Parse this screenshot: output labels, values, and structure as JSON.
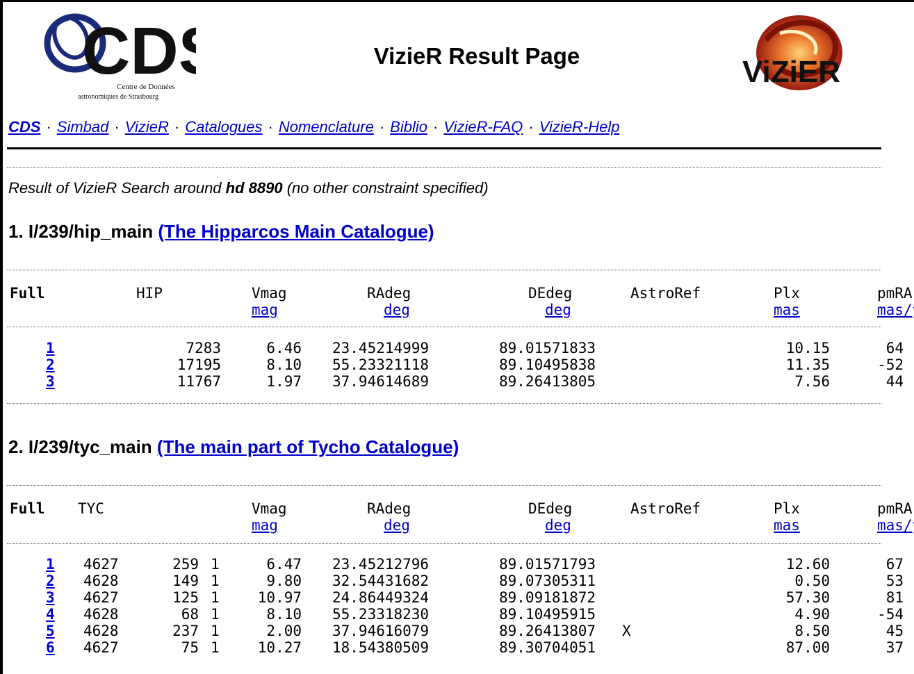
{
  "header": {
    "title": "VizieR Result Page",
    "cds_logo_text": "CDS",
    "cds_logo_subtitle_1": "Centre de Données",
    "cds_logo_subtitle_2": "astronomiques de Strasbourg",
    "vizier_logo_text": "ViZiER"
  },
  "nav": [
    {
      "label": "CDS"
    },
    {
      "label": "Simbad"
    },
    {
      "label": "VizieR"
    },
    {
      "label": "Catalogues"
    },
    {
      "label": "Nomenclature"
    },
    {
      "label": "Biblio"
    },
    {
      "label": "VizieR-FAQ"
    },
    {
      "label": "VizieR-Help"
    }
  ],
  "search": {
    "prefix": "Result of VizieR Search around",
    "target": "hd 8890",
    "suffix": "(no other constraint specified)"
  },
  "catalogs": [
    {
      "number": "1. I/239/hip_main",
      "link": "(The Hipparcos Main Catalogue)",
      "headers": {
        "full": "Full",
        "id": "HIP",
        "vmag": "Vmag",
        "vmag_unit": "mag",
        "ra": "RAdeg",
        "ra_unit": "deg",
        "de": "DEdeg",
        "de_unit": "deg",
        "astroref": "AstroRef",
        "plx": "Plx",
        "plx_unit": "mas",
        "pmra": "pmRA",
        "pmra_unit": "mas/yr"
      },
      "rows": [
        {
          "n": "1",
          "id": "7283",
          "vmag": "6.46",
          "ra": "23.45214999",
          "de": "89.01571833",
          "astroref": "",
          "plx": "10.15",
          "pmra": "64"
        },
        {
          "n": "2",
          "id": "17195",
          "vmag": "8.10",
          "ra": "55.23321118",
          "de": "89.10495838",
          "astroref": "",
          "plx": "11.35",
          "pmra": "-52"
        },
        {
          "n": "3",
          "id": "11767",
          "vmag": "1.97",
          "ra": "37.94614689",
          "de": "89.26413805",
          "astroref": "",
          "plx": "7.56",
          "pmra": "44"
        }
      ]
    },
    {
      "number": "2. I/239/tyc_main",
      "link": "(The main part of Tycho Catalogue)",
      "headers": {
        "full": "Full",
        "id": "TYC",
        "vmag": "Vmag",
        "vmag_unit": "mag",
        "ra": "RAdeg",
        "ra_unit": "deg",
        "de": "DEdeg",
        "de_unit": "deg",
        "astroref": "AstroRef",
        "plx": "Plx",
        "plx_unit": "mas",
        "pmra": "pmRA",
        "pmra_unit": "mas/yr"
      },
      "rows": [
        {
          "n": "1",
          "id1": "4627",
          "id2": "259",
          "id3": "1",
          "vmag": "6.47",
          "ra": "23.45212796",
          "de": "89.01571793",
          "astroref": "",
          "plx": "12.60",
          "pmra": "67"
        },
        {
          "n": "2",
          "id1": "4628",
          "id2": "149",
          "id3": "1",
          "vmag": "9.80",
          "ra": "32.54431682",
          "de": "89.07305311",
          "astroref": "",
          "plx": "0.50",
          "pmra": "53"
        },
        {
          "n": "3",
          "id1": "4627",
          "id2": "125",
          "id3": "1",
          "vmag": "10.97",
          "ra": "24.86449324",
          "de": "89.09181872",
          "astroref": "",
          "plx": "57.30",
          "pmra": "81"
        },
        {
          "n": "4",
          "id1": "4628",
          "id2": "68",
          "id3": "1",
          "vmag": "8.10",
          "ra": "55.23318230",
          "de": "89.10495915",
          "astroref": "",
          "plx": "4.90",
          "pmra": "-54"
        },
        {
          "n": "5",
          "id1": "4628",
          "id2": "237",
          "id3": "1",
          "vmag": "2.00",
          "ra": "37.94616079",
          "de": "89.26413807",
          "astroref": "X",
          "plx": "8.50",
          "pmra": "45"
        },
        {
          "n": "6",
          "id1": "4627",
          "id2": "75",
          "id3": "1",
          "vmag": "10.27",
          "ra": "18.54380509",
          "de": "89.30704051",
          "astroref": "",
          "plx": "87.00",
          "pmra": "37"
        }
      ]
    }
  ]
}
